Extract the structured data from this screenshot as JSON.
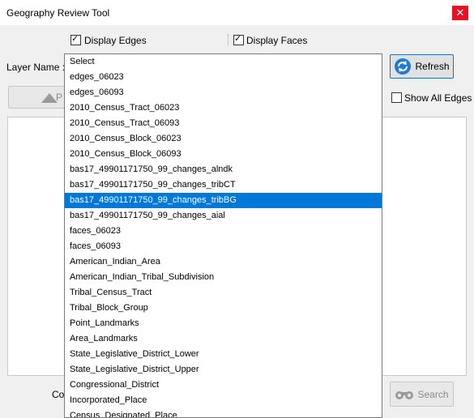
{
  "window": {
    "title": "Geography Review Tool",
    "close_glyph": "✕"
  },
  "checkboxes": {
    "display_edges": {
      "label": "Display Edges",
      "checked": true
    },
    "display_faces": {
      "label": "Display Faces",
      "checked": true
    },
    "show_all_edges": {
      "label": "Show All Edges",
      "checked": false
    }
  },
  "layer": {
    "label": "Layer Name :"
  },
  "buttons": {
    "refresh": "Refresh",
    "previous_partial": "P",
    "search": "Search",
    "col_partial": "Col"
  },
  "dropdown": {
    "selected_index": 9,
    "items": [
      "Select",
      "edges_06023",
      "edges_06093",
      "2010_Census_Tract_06023",
      "2010_Census_Tract_06093",
      "2010_Census_Block_06023",
      "2010_Census_Block_06093",
      "bas17_49901171750_99_changes_alndk",
      "bas17_49901171750_99_changes_tribCT",
      "bas17_49901171750_99_changes_tribBG",
      "bas17_49901171750_99_changes_aial",
      "faces_06023",
      "faces_06093",
      "American_Indian_Area",
      "American_Indian_Tribal_Subdivision",
      "Tribal_Census_Tract",
      "Tribal_Block_Group",
      "Point_Landmarks",
      "Area_Landmarks",
      "State_Legislative_District_Lower",
      "State_Legislative_District_Upper",
      "Congressional_District",
      "Incorporated_Place",
      "Census_Designated_Place"
    ]
  },
  "colors": {
    "selection": "#0078d7",
    "close": "#e81123"
  }
}
